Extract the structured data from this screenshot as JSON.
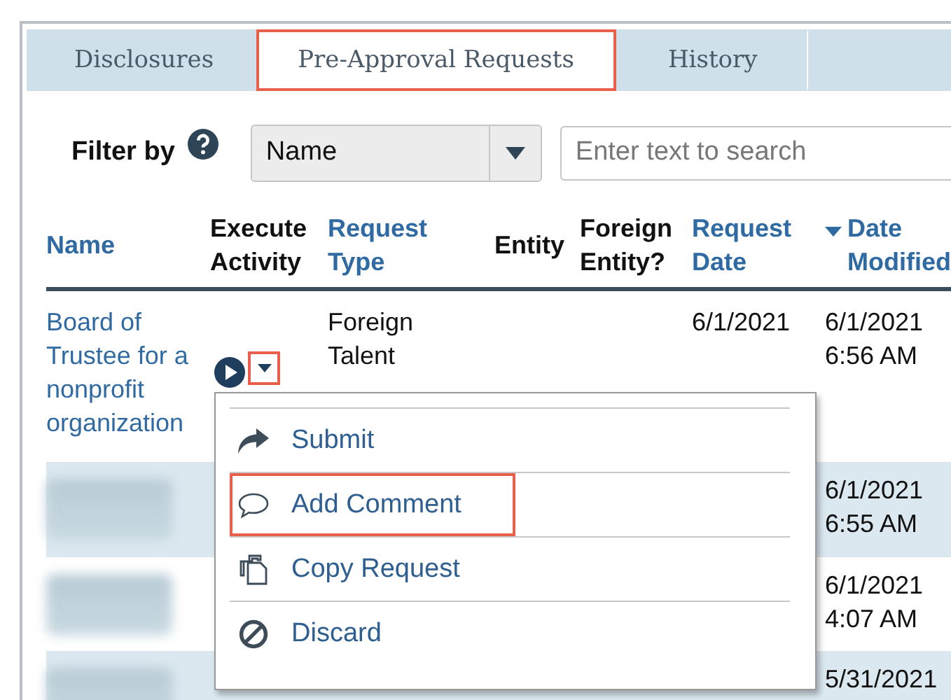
{
  "tabs": [
    {
      "label": "Disclosures",
      "selected": false,
      "highlighted": false
    },
    {
      "label": "Pre-Approval Requests",
      "selected": true,
      "highlighted": true
    },
    {
      "label": "History",
      "selected": false,
      "highlighted": false
    }
  ],
  "filter": {
    "label": "Filter by",
    "select_value": "Name",
    "search_placeholder": "Enter text to search"
  },
  "table": {
    "columns": [
      {
        "label": "Name",
        "sortable": true,
        "sorted": false
      },
      {
        "label": "Execute Activity",
        "sortable": false,
        "sorted": false
      },
      {
        "label": "Request Type",
        "sortable": true,
        "sorted": false
      },
      {
        "label": "Entity",
        "sortable": false,
        "sorted": false
      },
      {
        "label": "Foreign Entity?",
        "sortable": false,
        "sorted": false
      },
      {
        "label": "Request Date",
        "sortable": true,
        "sorted": false
      },
      {
        "label": "Date Modified",
        "sortable": true,
        "sorted": true
      }
    ],
    "rows": [
      {
        "name": "Board of Trustee for a nonprofit organization",
        "redacted": false,
        "request_type": "Foreign Talent",
        "request_date": "6/1/2021",
        "date_modified": "6/1/2021 6:56 AM",
        "dropdown_highlighted": true
      },
      {
        "redacted": true,
        "date_modified": "6/1/2021 6:55 AM"
      },
      {
        "redacted": true,
        "date_modified": "6/1/2021 4:07 AM"
      },
      {
        "redacted": true,
        "date_modified": "5/31/2021"
      }
    ]
  },
  "menu": {
    "open": true,
    "items": [
      {
        "kind": "submit",
        "label": "Submit",
        "highlighted": false
      },
      {
        "kind": "comment",
        "label": "Add Comment",
        "highlighted": true
      },
      {
        "kind": "copy",
        "label": "Copy Request",
        "highlighted": false
      },
      {
        "kind": "discard",
        "label": "Discard",
        "highlighted": false
      }
    ]
  }
}
